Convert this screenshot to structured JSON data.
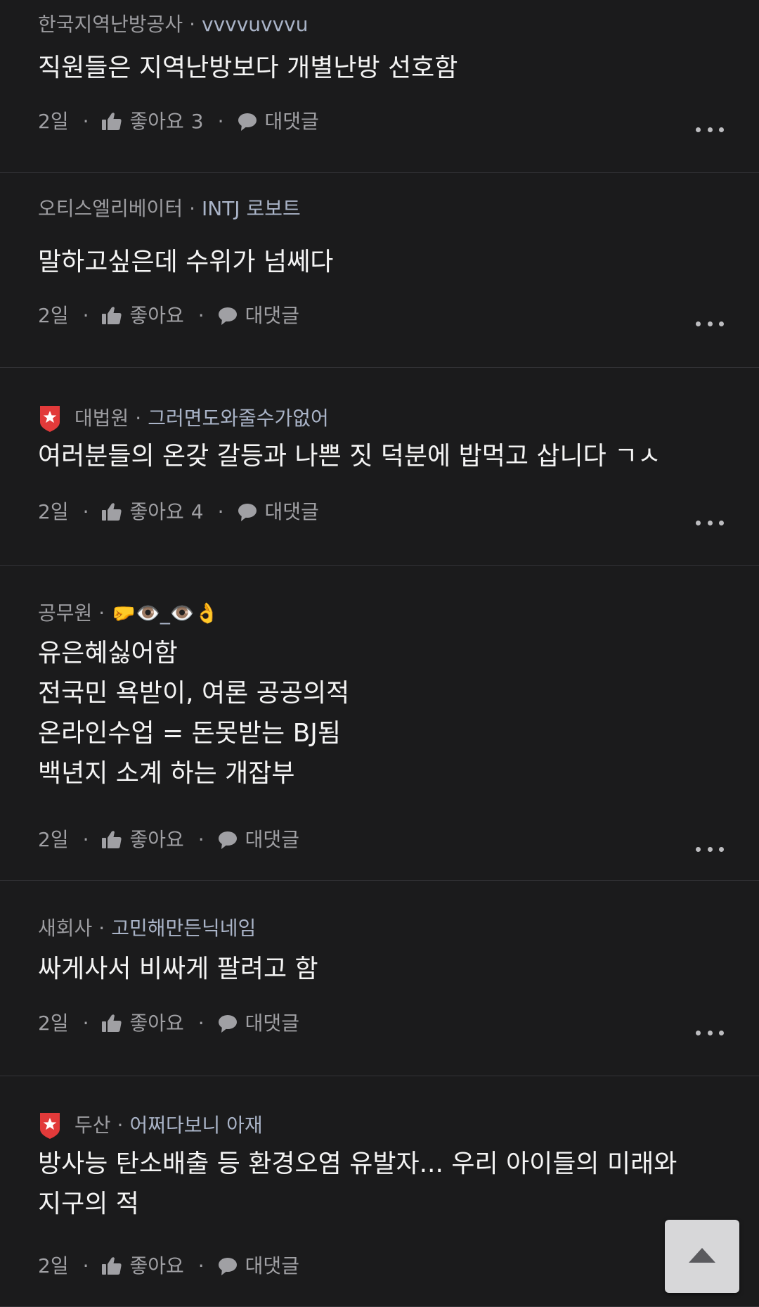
{
  "comments": [
    {
      "company": "한국지역난방공사",
      "nickname": "vvvvuvvvu",
      "has_badge": false,
      "lines": [
        "직원들은 지역난방보다 개별난방 선호함"
      ],
      "time": "2일",
      "like_label": "좋아요",
      "like_count": "3",
      "reply_label": "대댓글"
    },
    {
      "company": "오티스엘리베이터",
      "nickname": "INTJ 로보트",
      "has_badge": false,
      "lines": [
        "말하고싶은데 수위가 넘쎄다"
      ],
      "time": "2일",
      "like_label": "좋아요",
      "like_count": "",
      "reply_label": "대댓글"
    },
    {
      "company": "대법원",
      "nickname": "그러면도와줄수가없어",
      "has_badge": true,
      "lines": [
        "여러분들의 온갖 갈등과 나쁜 짓 덕분에 밥먹고 삽니다 ㄱㅅ"
      ],
      "time": "2일",
      "like_label": "좋아요",
      "like_count": "4",
      "reply_label": "대댓글"
    },
    {
      "company": "공무원",
      "nickname": "🤛👁️_👁️👌",
      "has_badge": false,
      "lines": [
        "유은혜싫어함",
        "전국민 욕받이, 여론 공공의적",
        "온라인수업 = 돈못받는 BJ됨",
        "백년지 소계 하는 개잡부"
      ],
      "time": "2일",
      "like_label": "좋아요",
      "like_count": "",
      "reply_label": "대댓글"
    },
    {
      "company": "새회사",
      "nickname": "고민해만든닉네임",
      "has_badge": false,
      "lines": [
        "싸게사서 비싸게 팔려고 함"
      ],
      "time": "2일",
      "like_label": "좋아요",
      "like_count": "",
      "reply_label": "대댓글"
    },
    {
      "company": "두산",
      "nickname": "어쩌다보니 아재",
      "has_badge": true,
      "lines": [
        "방사능 탄소배출 등 환경오염 유발자... 우리 아이들의 미래와",
        "지구의 적"
      ],
      "time": "2일",
      "like_label": "좋아요",
      "like_count": "",
      "reply_label": "대댓글"
    }
  ],
  "icons": {
    "like": "thumbs-up-icon",
    "reply": "speech-bubble-icon",
    "more": "more-horizontal-icon",
    "badge": "red-shield-star-icon",
    "scroll_top": "triangle-up-icon"
  },
  "colors": {
    "background": "#1b1b1c",
    "body_text": "#f4f4f4",
    "meta_text": "#9c9ca0",
    "nickname": "#aab4c8",
    "badge_red": "#e23a3a",
    "scroll_top_bg": "#d7d7d9"
  }
}
